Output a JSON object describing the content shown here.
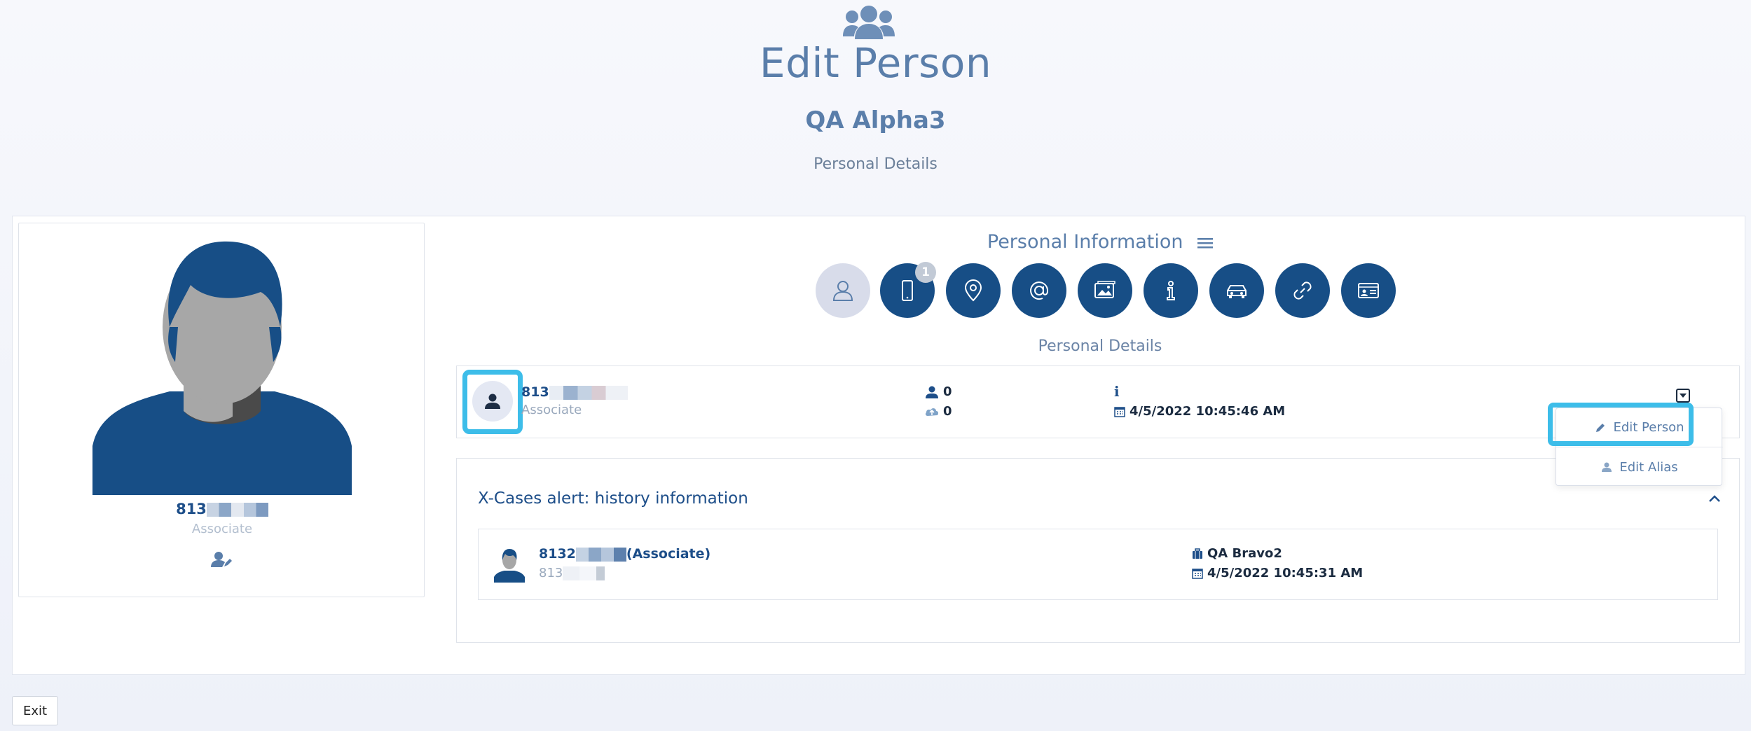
{
  "header": {
    "icon": "people-group-icon",
    "title": "Edit Person",
    "person_name": "QA Alpha3",
    "subtitle": "Personal Details"
  },
  "profile": {
    "id_prefix": "813",
    "role": "Associate",
    "avatar_icon": "person-avatar-icon",
    "action_icon": "user-edit-icon"
  },
  "personal_info": {
    "title": "Personal Information",
    "menu_icon": "hamburger-menu-icon",
    "category_buttons": [
      {
        "icon": "person-outline-icon",
        "active": true
      },
      {
        "icon": "mobile-phone-icon",
        "badge": "1"
      },
      {
        "icon": "location-pin-icon"
      },
      {
        "icon": "at-sign-icon"
      },
      {
        "icon": "image-gallery-icon"
      },
      {
        "icon": "info-icon"
      },
      {
        "icon": "car-icon"
      },
      {
        "icon": "link-icon"
      },
      {
        "icon": "id-card-icon"
      }
    ],
    "section_label": "Personal Details"
  },
  "detail_row": {
    "id_prefix": "813",
    "role": "Associate",
    "persons_count": "0",
    "uploads_count": "0",
    "info_mark": "i",
    "date": "4/5/2022 10:45:46 AM"
  },
  "dropdown": {
    "items": [
      "Edit Person",
      "Edit Alias"
    ]
  },
  "alert": {
    "title": "X-Cases alert: history information",
    "entry": {
      "name_prefix": "8132",
      "name_suffix": "(Associate)",
      "sub_prefix": "813",
      "case_name": "QA Bravo2",
      "date": "4/5/2022 10:45:31 AM"
    }
  },
  "footer": {
    "exit_label": "Exit"
  },
  "colors": {
    "primary": "#174e86",
    "highlight": "#3dbde9",
    "title_text": "#5a7eaa"
  }
}
